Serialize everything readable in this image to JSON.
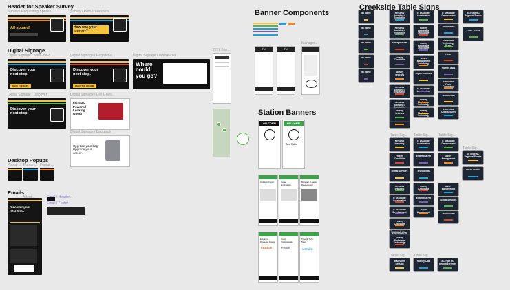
{
  "sections": {
    "speaker_survey": "Header for Speaker Survey",
    "digital_signage": "Digital Signage",
    "desktop_popups": "Desktop Popups",
    "emails": "Emails",
    "banner_components": "Banner Components",
    "station_banners": "Station Banners",
    "creekside_table_signs": "Creekside Table Signs"
  },
  "labels": {
    "survey_requesting": "Survey / Requesting Speake...",
    "survey_post": "Survey / Post-Tradeshow",
    "ds_save": "Digital Signage / Save-the-d...",
    "ds_register": "Digital Signage / Register-o...",
    "ds_where": "Digital Signage / Where-cou...",
    "ds_discover": "Digital Signage / Discover",
    "ds_dell": "Digital Signage / Dell Gives...",
    "ds_backpack": "Digital Signage / Backpack",
    "ban_2017": "2017 Ban...",
    "manager": "Manager...",
    "popup_a": "Popup ...",
    "popup_b": "Popup ...",
    "popup_c": "Popup ...",
    "email_attent": "Attent...",
    "email_header": "Email / Header...",
    "email_footer": "Email / Footer",
    "table_sig_1": "Table Sig...",
    "table_sig_2": "Table Sig...",
    "table_sig_3": "Table Sig...",
    "table_sig_4": "Table Sig...",
    "table_sig_5": "Table Sig...",
    "table_sig_6": "Table Sig...",
    "table_sig_7": "Table Sig..."
  },
  "survey": {
    "all_aboard": "All aboard!",
    "how_journey": "How was your journey?"
  },
  "signage": {
    "discover_1": "Discover your next stop.",
    "discover_2": "Discover your next stop.",
    "discover_3": "Discover your next stop.",
    "button_save": "SAVE THE DATE",
    "button_register": "REGISTER ONLINE",
    "where_could": "Where could you go?",
    "flexible": "Flexible, Powerful Looking Good!",
    "upgrade": "Upgrade your bag. Upgrade your career."
  },
  "email": {
    "discover": "Discover your next stop."
  },
  "banners": {
    "tile": "Tile",
    "welcome": "WELCOME!",
    "wellcome2": "WELCOME!",
    "ted_talks": "Ted Talks",
    "inclusion": "Inclusion Center",
    "tower": "Tower Jumpstation",
    "manager_leader": "Manager / Leader Development",
    "employee_groups": "Employee Resource Groups",
    "young_prof": "Young Professionals",
    "triangle_tech": "Triangle Tech Talks",
    "enable": "ENABLE",
    "witsig": "WITSIG",
    "pride": "PRIDE"
  },
  "table_signs": {
    "col1": [
      "IBI Name",
      "IBI Name",
      "IBI Name",
      "IBI Name",
      "IBI Name"
    ],
    "col2": [
      "Personal branding / Reputation",
      "Personal branding / Reputation",
      "Enterprise HR",
      "Fidelity Charitable",
      "Military Veterans"
    ],
    "col3": [
      "IT Associate Acceleration",
      "Fidelity Brokerage Technology",
      "Fidelity Brokerage Technology",
      "Asset Management Technology",
      "Digital Services"
    ],
    "col4": [
      "IT Associate Development",
      "FidelityWeb",
      "Advanced Technology Group",
      "FCAT",
      "Fidelity Labs",
      "Enterprise Cloud Computing",
      "Technocrats",
      "Enterprise Cybersecurity"
    ],
    "col5": [
      "ACTriple NC Regional Events",
      "FRIAT Works"
    ],
    "lower": [
      "Personal branding",
      "IT Associate Acceleration",
      "IT Associate Development",
      "Fidelity Charitable",
      "Enterprise HR",
      "Asset Management",
      "Digital Services",
      "Technocrats"
    ],
    "bottom": [
      "Brainstorm Session",
      "Fidelity Labs",
      "ACTriple NC Regional Events"
    ]
  },
  "colors": {
    "yellow": "#f6c33c",
    "orange": "#f08a1c",
    "blue": "#1fa0d8",
    "green": "#5ab24a",
    "purple": "#7a5bb0",
    "red": "#d8432b",
    "dark": "#111111",
    "sign": "#1f2633"
  }
}
